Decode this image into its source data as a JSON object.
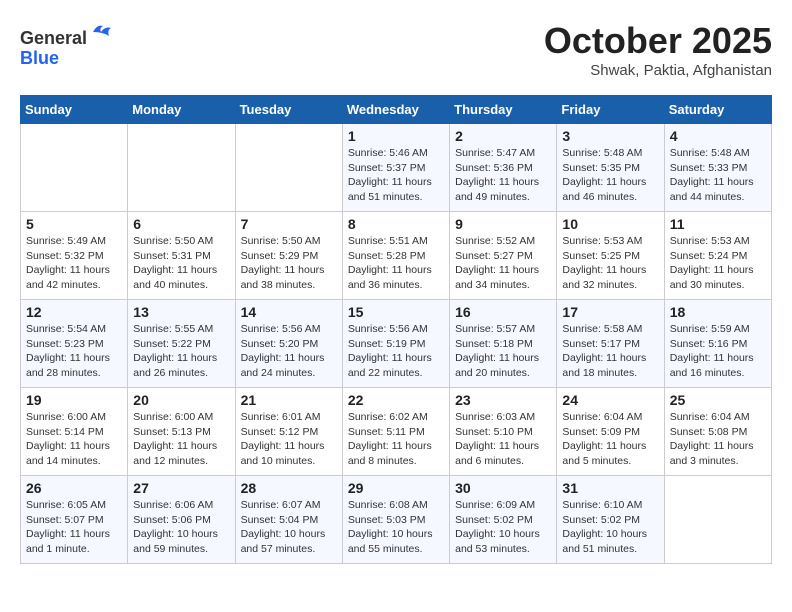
{
  "header": {
    "logo_general": "General",
    "logo_blue": "Blue",
    "month_title": "October 2025",
    "location": "Shwak, Paktia, Afghanistan"
  },
  "weekdays": [
    "Sunday",
    "Monday",
    "Tuesday",
    "Wednesday",
    "Thursday",
    "Friday",
    "Saturday"
  ],
  "weeks": [
    [
      {
        "day": "",
        "info": ""
      },
      {
        "day": "",
        "info": ""
      },
      {
        "day": "",
        "info": ""
      },
      {
        "day": "1",
        "info": "Sunrise: 5:46 AM\nSunset: 5:37 PM\nDaylight: 11 hours\nand 51 minutes."
      },
      {
        "day": "2",
        "info": "Sunrise: 5:47 AM\nSunset: 5:36 PM\nDaylight: 11 hours\nand 49 minutes."
      },
      {
        "day": "3",
        "info": "Sunrise: 5:48 AM\nSunset: 5:35 PM\nDaylight: 11 hours\nand 46 minutes."
      },
      {
        "day": "4",
        "info": "Sunrise: 5:48 AM\nSunset: 5:33 PM\nDaylight: 11 hours\nand 44 minutes."
      }
    ],
    [
      {
        "day": "5",
        "info": "Sunrise: 5:49 AM\nSunset: 5:32 PM\nDaylight: 11 hours\nand 42 minutes."
      },
      {
        "day": "6",
        "info": "Sunrise: 5:50 AM\nSunset: 5:31 PM\nDaylight: 11 hours\nand 40 minutes."
      },
      {
        "day": "7",
        "info": "Sunrise: 5:50 AM\nSunset: 5:29 PM\nDaylight: 11 hours\nand 38 minutes."
      },
      {
        "day": "8",
        "info": "Sunrise: 5:51 AM\nSunset: 5:28 PM\nDaylight: 11 hours\nand 36 minutes."
      },
      {
        "day": "9",
        "info": "Sunrise: 5:52 AM\nSunset: 5:27 PM\nDaylight: 11 hours\nand 34 minutes."
      },
      {
        "day": "10",
        "info": "Sunrise: 5:53 AM\nSunset: 5:25 PM\nDaylight: 11 hours\nand 32 minutes."
      },
      {
        "day": "11",
        "info": "Sunrise: 5:53 AM\nSunset: 5:24 PM\nDaylight: 11 hours\nand 30 minutes."
      }
    ],
    [
      {
        "day": "12",
        "info": "Sunrise: 5:54 AM\nSunset: 5:23 PM\nDaylight: 11 hours\nand 28 minutes."
      },
      {
        "day": "13",
        "info": "Sunrise: 5:55 AM\nSunset: 5:22 PM\nDaylight: 11 hours\nand 26 minutes."
      },
      {
        "day": "14",
        "info": "Sunrise: 5:56 AM\nSunset: 5:20 PM\nDaylight: 11 hours\nand 24 minutes."
      },
      {
        "day": "15",
        "info": "Sunrise: 5:56 AM\nSunset: 5:19 PM\nDaylight: 11 hours\nand 22 minutes."
      },
      {
        "day": "16",
        "info": "Sunrise: 5:57 AM\nSunset: 5:18 PM\nDaylight: 11 hours\nand 20 minutes."
      },
      {
        "day": "17",
        "info": "Sunrise: 5:58 AM\nSunset: 5:17 PM\nDaylight: 11 hours\nand 18 minutes."
      },
      {
        "day": "18",
        "info": "Sunrise: 5:59 AM\nSunset: 5:16 PM\nDaylight: 11 hours\nand 16 minutes."
      }
    ],
    [
      {
        "day": "19",
        "info": "Sunrise: 6:00 AM\nSunset: 5:14 PM\nDaylight: 11 hours\nand 14 minutes."
      },
      {
        "day": "20",
        "info": "Sunrise: 6:00 AM\nSunset: 5:13 PM\nDaylight: 11 hours\nand 12 minutes."
      },
      {
        "day": "21",
        "info": "Sunrise: 6:01 AM\nSunset: 5:12 PM\nDaylight: 11 hours\nand 10 minutes."
      },
      {
        "day": "22",
        "info": "Sunrise: 6:02 AM\nSunset: 5:11 PM\nDaylight: 11 hours\nand 8 minutes."
      },
      {
        "day": "23",
        "info": "Sunrise: 6:03 AM\nSunset: 5:10 PM\nDaylight: 11 hours\nand 6 minutes."
      },
      {
        "day": "24",
        "info": "Sunrise: 6:04 AM\nSunset: 5:09 PM\nDaylight: 11 hours\nand 5 minutes."
      },
      {
        "day": "25",
        "info": "Sunrise: 6:04 AM\nSunset: 5:08 PM\nDaylight: 11 hours\nand 3 minutes."
      }
    ],
    [
      {
        "day": "26",
        "info": "Sunrise: 6:05 AM\nSunset: 5:07 PM\nDaylight: 11 hours\nand 1 minute."
      },
      {
        "day": "27",
        "info": "Sunrise: 6:06 AM\nSunset: 5:06 PM\nDaylight: 10 hours\nand 59 minutes."
      },
      {
        "day": "28",
        "info": "Sunrise: 6:07 AM\nSunset: 5:04 PM\nDaylight: 10 hours\nand 57 minutes."
      },
      {
        "day": "29",
        "info": "Sunrise: 6:08 AM\nSunset: 5:03 PM\nDaylight: 10 hours\nand 55 minutes."
      },
      {
        "day": "30",
        "info": "Sunrise: 6:09 AM\nSunset: 5:02 PM\nDaylight: 10 hours\nand 53 minutes."
      },
      {
        "day": "31",
        "info": "Sunrise: 6:10 AM\nSunset: 5:02 PM\nDaylight: 10 hours\nand 51 minutes."
      },
      {
        "day": "",
        "info": ""
      }
    ]
  ]
}
